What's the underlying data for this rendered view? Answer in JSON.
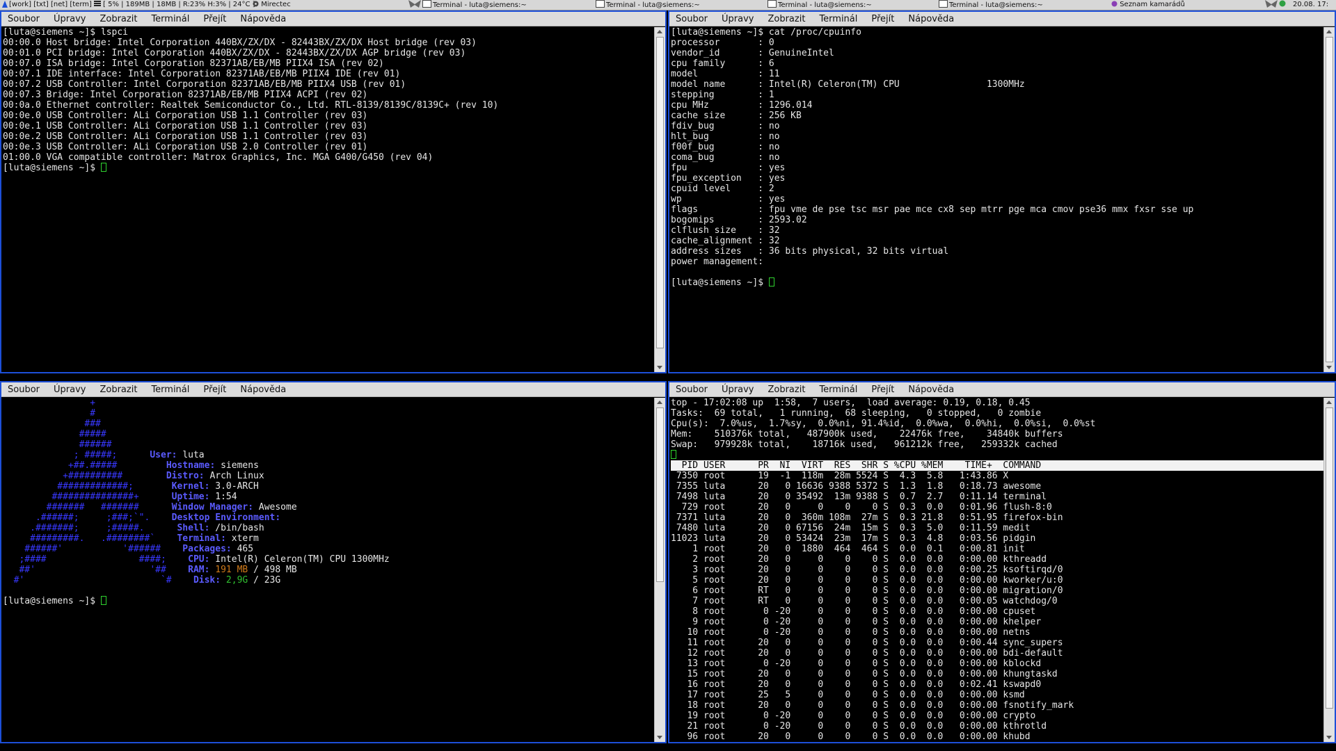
{
  "topbar": {
    "tags": [
      "[work]",
      "[txt]",
      "[net]",
      "[term]"
    ],
    "stats": "[ 5% | 189MB | 18MB | R:23% H:3% | 24°C ]",
    "player": "Mirectec",
    "tasks": [
      "Terminal - luta@siemens:~",
      "Terminal - luta@siemens:~",
      "Terminal - luta@siemens:~",
      "Terminal - luta@siemens:~"
    ],
    "buddy": "Seznam kamarádů",
    "clock": "20.08. 17:"
  },
  "menu": [
    "Soubor",
    "Úpravy",
    "Zobrazit",
    "Terminál",
    "Přejít",
    "Nápověda"
  ],
  "win_tl": {
    "lines": [
      "[luta@siemens ~]$ lspci",
      "00:00.0 Host bridge: Intel Corporation 440BX/ZX/DX - 82443BX/ZX/DX Host bridge (rev 03)",
      "00:01.0 PCI bridge: Intel Corporation 440BX/ZX/DX - 82443BX/ZX/DX AGP bridge (rev 03)",
      "00:07.0 ISA bridge: Intel Corporation 82371AB/EB/MB PIIX4 ISA (rev 02)",
      "00:07.1 IDE interface: Intel Corporation 82371AB/EB/MB PIIX4 IDE (rev 01)",
      "00:07.2 USB Controller: Intel Corporation 82371AB/EB/MB PIIX4 USB (rev 01)",
      "00:07.3 Bridge: Intel Corporation 82371AB/EB/MB PIIX4 ACPI (rev 02)",
      "00:0a.0 Ethernet controller: Realtek Semiconductor Co., Ltd. RTL-8139/8139C/8139C+ (rev 10)",
      "00:0e.0 USB Controller: ALi Corporation USB 1.1 Controller (rev 03)",
      "00:0e.1 USB Controller: ALi Corporation USB 1.1 Controller (rev 03)",
      "00:0e.2 USB Controller: ALi Corporation USB 1.1 Controller (rev 03)",
      "00:0e.3 USB Controller: ALi Corporation USB 2.0 Controller (rev 01)",
      "01:00.0 VGA compatible controller: Matrox Graphics, Inc. MGA G400/G450 (rev 04)"
    ],
    "prompt": "[luta@siemens ~]$ "
  },
  "win_tr": {
    "lines": [
      "[luta@siemens ~]$ cat /proc/cpuinfo",
      "processor       : 0",
      "vendor_id       : GenuineIntel",
      "cpu family      : 6",
      "model           : 11",
      "model name      : Intel(R) Celeron(TM) CPU                1300MHz",
      "stepping        : 1",
      "cpu MHz         : 1296.014",
      "cache size      : 256 KB",
      "fdiv_bug        : no",
      "hlt_bug         : no",
      "f00f_bug        : no",
      "coma_bug        : no",
      "fpu             : yes",
      "fpu_exception   : yes",
      "cpuid level     : 2",
      "wp              : yes",
      "flags           : fpu vme de pse tsc msr pae mce cx8 sep mtrr pge mca cmov pse36 mmx fxsr sse up",
      "bogomips        : 2593.02",
      "clflush size    : 32",
      "cache_alignment : 32",
      "address sizes   : 36 bits physical, 32 bits virtual",
      "power management:",
      ""
    ],
    "prompt": "[luta@siemens ~]$ "
  },
  "win_bl": {
    "logo": [
      "                +",
      "                #",
      "               ###",
      "              #####",
      "              ######",
      "             ; #####;",
      "            +##.#####",
      "           +##########",
      "          #############;",
      "         ###############+",
      "        #######   #######",
      "      .######;     ;###;`\".",
      "     .#######;     ;#####.",
      "     #########.   .########`",
      "    ######'           '######",
      "   ;####                 ####;",
      "   ##'                     '##",
      "  #'                         `#"
    ],
    "info": [
      {
        "label": "User:",
        "value": "luta"
      },
      {
        "label": "Hostname:",
        "value": "siemens"
      },
      {
        "label": "Distro:",
        "value": "Arch Linux"
      },
      {
        "label": "Kernel:",
        "value": "3.0-ARCH"
      },
      {
        "label": "Uptime:",
        "value": "1:54"
      },
      {
        "label": "Window Manager:",
        "value": "Awesome"
      },
      {
        "label": "Desktop Environment:",
        "value": ""
      },
      {
        "label": "Shell:",
        "value": "/bin/bash"
      },
      {
        "label": "Terminal:",
        "value": "xterm"
      },
      {
        "label": "Packages:",
        "value": "465"
      },
      {
        "label": "CPU:",
        "value": "Intel(R) Celeron(TM) CPU 1300MHz"
      }
    ],
    "ram_label": "RAM:",
    "ram_used": "191 MB",
    "ram_total": "/ 498 MB",
    "disk_label": "Disk:",
    "disk_used": "2,9G",
    "disk_total": "/ 23G",
    "prompt": "[luta@siemens ~]$ "
  },
  "win_br": {
    "summary": [
      "top - 17:02:08 up  1:58,  7 users,  load average: 0.19, 0.18, 0.45",
      "Tasks:  69 total,   1 running,  68 sleeping,   0 stopped,   0 zombie",
      "Cpu(s):  7.0%us,  1.7%sy,  0.0%ni, 91.4%id,  0.0%wa,  0.0%hi,  0.0%si,  0.0%st",
      "Mem:    510376k total,   487900k used,    22476k free,    34840k buffers",
      "Swap:   979928k total,    18716k used,   961212k free,   259332k cached"
    ],
    "header": "  PID USER      PR  NI  VIRT  RES  SHR S %CPU %MEM    TIME+  COMMAND",
    "rows": [
      " 7350 root      19  -1  118m  28m 5524 S  4.3  5.8   1:43.86 X",
      " 7355 luta      20   0 16636 9388 5372 S  1.3  1.8   0:18.73 awesome",
      " 7498 luta      20   0 35492  13m 9388 S  0.7  2.7   0:11.14 terminal",
      "  729 root      20   0     0    0    0 S  0.3  0.0   0:01.96 flush-8:0",
      " 7371 luta      20   0  360m 108m  27m S  0.3 21.8   0:51.95 firefox-bin",
      " 7480 luta      20   0 67156  24m  15m S  0.3  5.0   0:11.59 medit",
      "11023 luta      20   0 53424  23m  17m S  0.3  4.8   0:03.56 pidgin",
      "    1 root      20   0  1880  464  464 S  0.0  0.1   0:00.81 init",
      "    2 root      20   0     0    0    0 S  0.0  0.0   0:00.00 kthreadd",
      "    3 root      20   0     0    0    0 S  0.0  0.0   0:00.25 ksoftirqd/0",
      "    5 root      20   0     0    0    0 S  0.0  0.0   0:00.00 kworker/u:0",
      "    6 root      RT   0     0    0    0 S  0.0  0.0   0:00.00 migration/0",
      "    7 root      RT   0     0    0    0 S  0.0  0.0   0:00.05 watchdog/0",
      "    8 root       0 -20     0    0    0 S  0.0  0.0   0:00.00 cpuset",
      "    9 root       0 -20     0    0    0 S  0.0  0.0   0:00.00 khelper",
      "   10 root       0 -20     0    0    0 S  0.0  0.0   0:00.00 netns",
      "   11 root      20   0     0    0    0 S  0.0  0.0   0:00.44 sync_supers",
      "   12 root      20   0     0    0    0 S  0.0  0.0   0:00.00 bdi-default",
      "   13 root       0 -20     0    0    0 S  0.0  0.0   0:00.00 kblockd",
      "   15 root      20   0     0    0    0 S  0.0  0.0   0:00.00 khungtaskd",
      "   16 root      20   0     0    0    0 S  0.0  0.0   0:02.41 kswapd0",
      "   17 root      25   5     0    0    0 S  0.0  0.0   0:00.00 ksmd",
      "   18 root      20   0     0    0    0 S  0.0  0.0   0:00.00 fsnotify_mark",
      "   19 root       0 -20     0    0    0 S  0.0  0.0   0:00.00 crypto",
      "   21 root       0 -20     0    0    0 S  0.0  0.0   0:00.00 kthrotld",
      "   96 root      20   0     0    0    0 S  0.0  0.0   0:00.00 khubd"
    ]
  }
}
